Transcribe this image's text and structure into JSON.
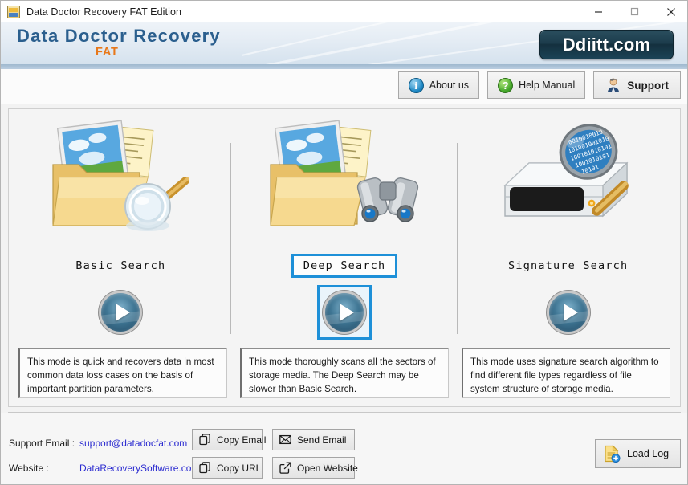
{
  "window": {
    "title": "Data Doctor Recovery FAT Edition",
    "icon": "app-icon",
    "controls": {
      "minimize": "minimize-icon",
      "maximize": "maximize-icon",
      "close": "close-icon"
    }
  },
  "header": {
    "brand_main": "Data Doctor Recovery",
    "brand_sub": "FAT",
    "logo": "Ddiitt.com",
    "accent_blue": "#2b5f8e",
    "accent_orange": "#e8781a"
  },
  "toolbar": {
    "buttons": [
      {
        "label": "About us",
        "icon": "info-icon",
        "glyph": "i"
      },
      {
        "label": "Help Manual",
        "icon": "question-mark-icon",
        "glyph": "?"
      },
      {
        "label": "Support",
        "icon": "person-icon",
        "glyph": ""
      }
    ]
  },
  "modes": [
    {
      "title": "Basic Search",
      "art": "folder-with-magnifier-icon",
      "selected": false,
      "description": "This mode is quick and recovers data in most common data loss cases on the basis of important partition parameters.",
      "play": "play-button-icon"
    },
    {
      "title": "Deep Search",
      "art": "folder-with-binoculars-icon",
      "selected": true,
      "description": "This mode thoroughly scans all the sectors of storage media. The Deep Search may be slower than Basic Search.",
      "play": "play-button-icon"
    },
    {
      "title": "Signature Search",
      "art": "hard-drive-with-magnifier-icon",
      "selected": false,
      "description": "This mode uses signature search algorithm to find different file types regardless of file system structure of storage media.",
      "play": "play-button-icon"
    }
  ],
  "selection_color": "#1e90d8",
  "footer": {
    "support_email_label": "Support Email :",
    "support_email_value": "support@datadocfat.com",
    "website_label": "Website :",
    "website_value": "DataRecoverySoftware.com",
    "link_color": "#2b2bd0",
    "buttons": [
      {
        "label": "Copy Email",
        "icon": "copy-icon"
      },
      {
        "label": "Send Email",
        "icon": "envelope-icon"
      },
      {
        "label": "Copy URL",
        "icon": "copy-icon"
      },
      {
        "label": "Open Website",
        "icon": "external-link-icon"
      }
    ],
    "load_log": {
      "label": "Load Log",
      "icon": "document-add-icon"
    }
  }
}
